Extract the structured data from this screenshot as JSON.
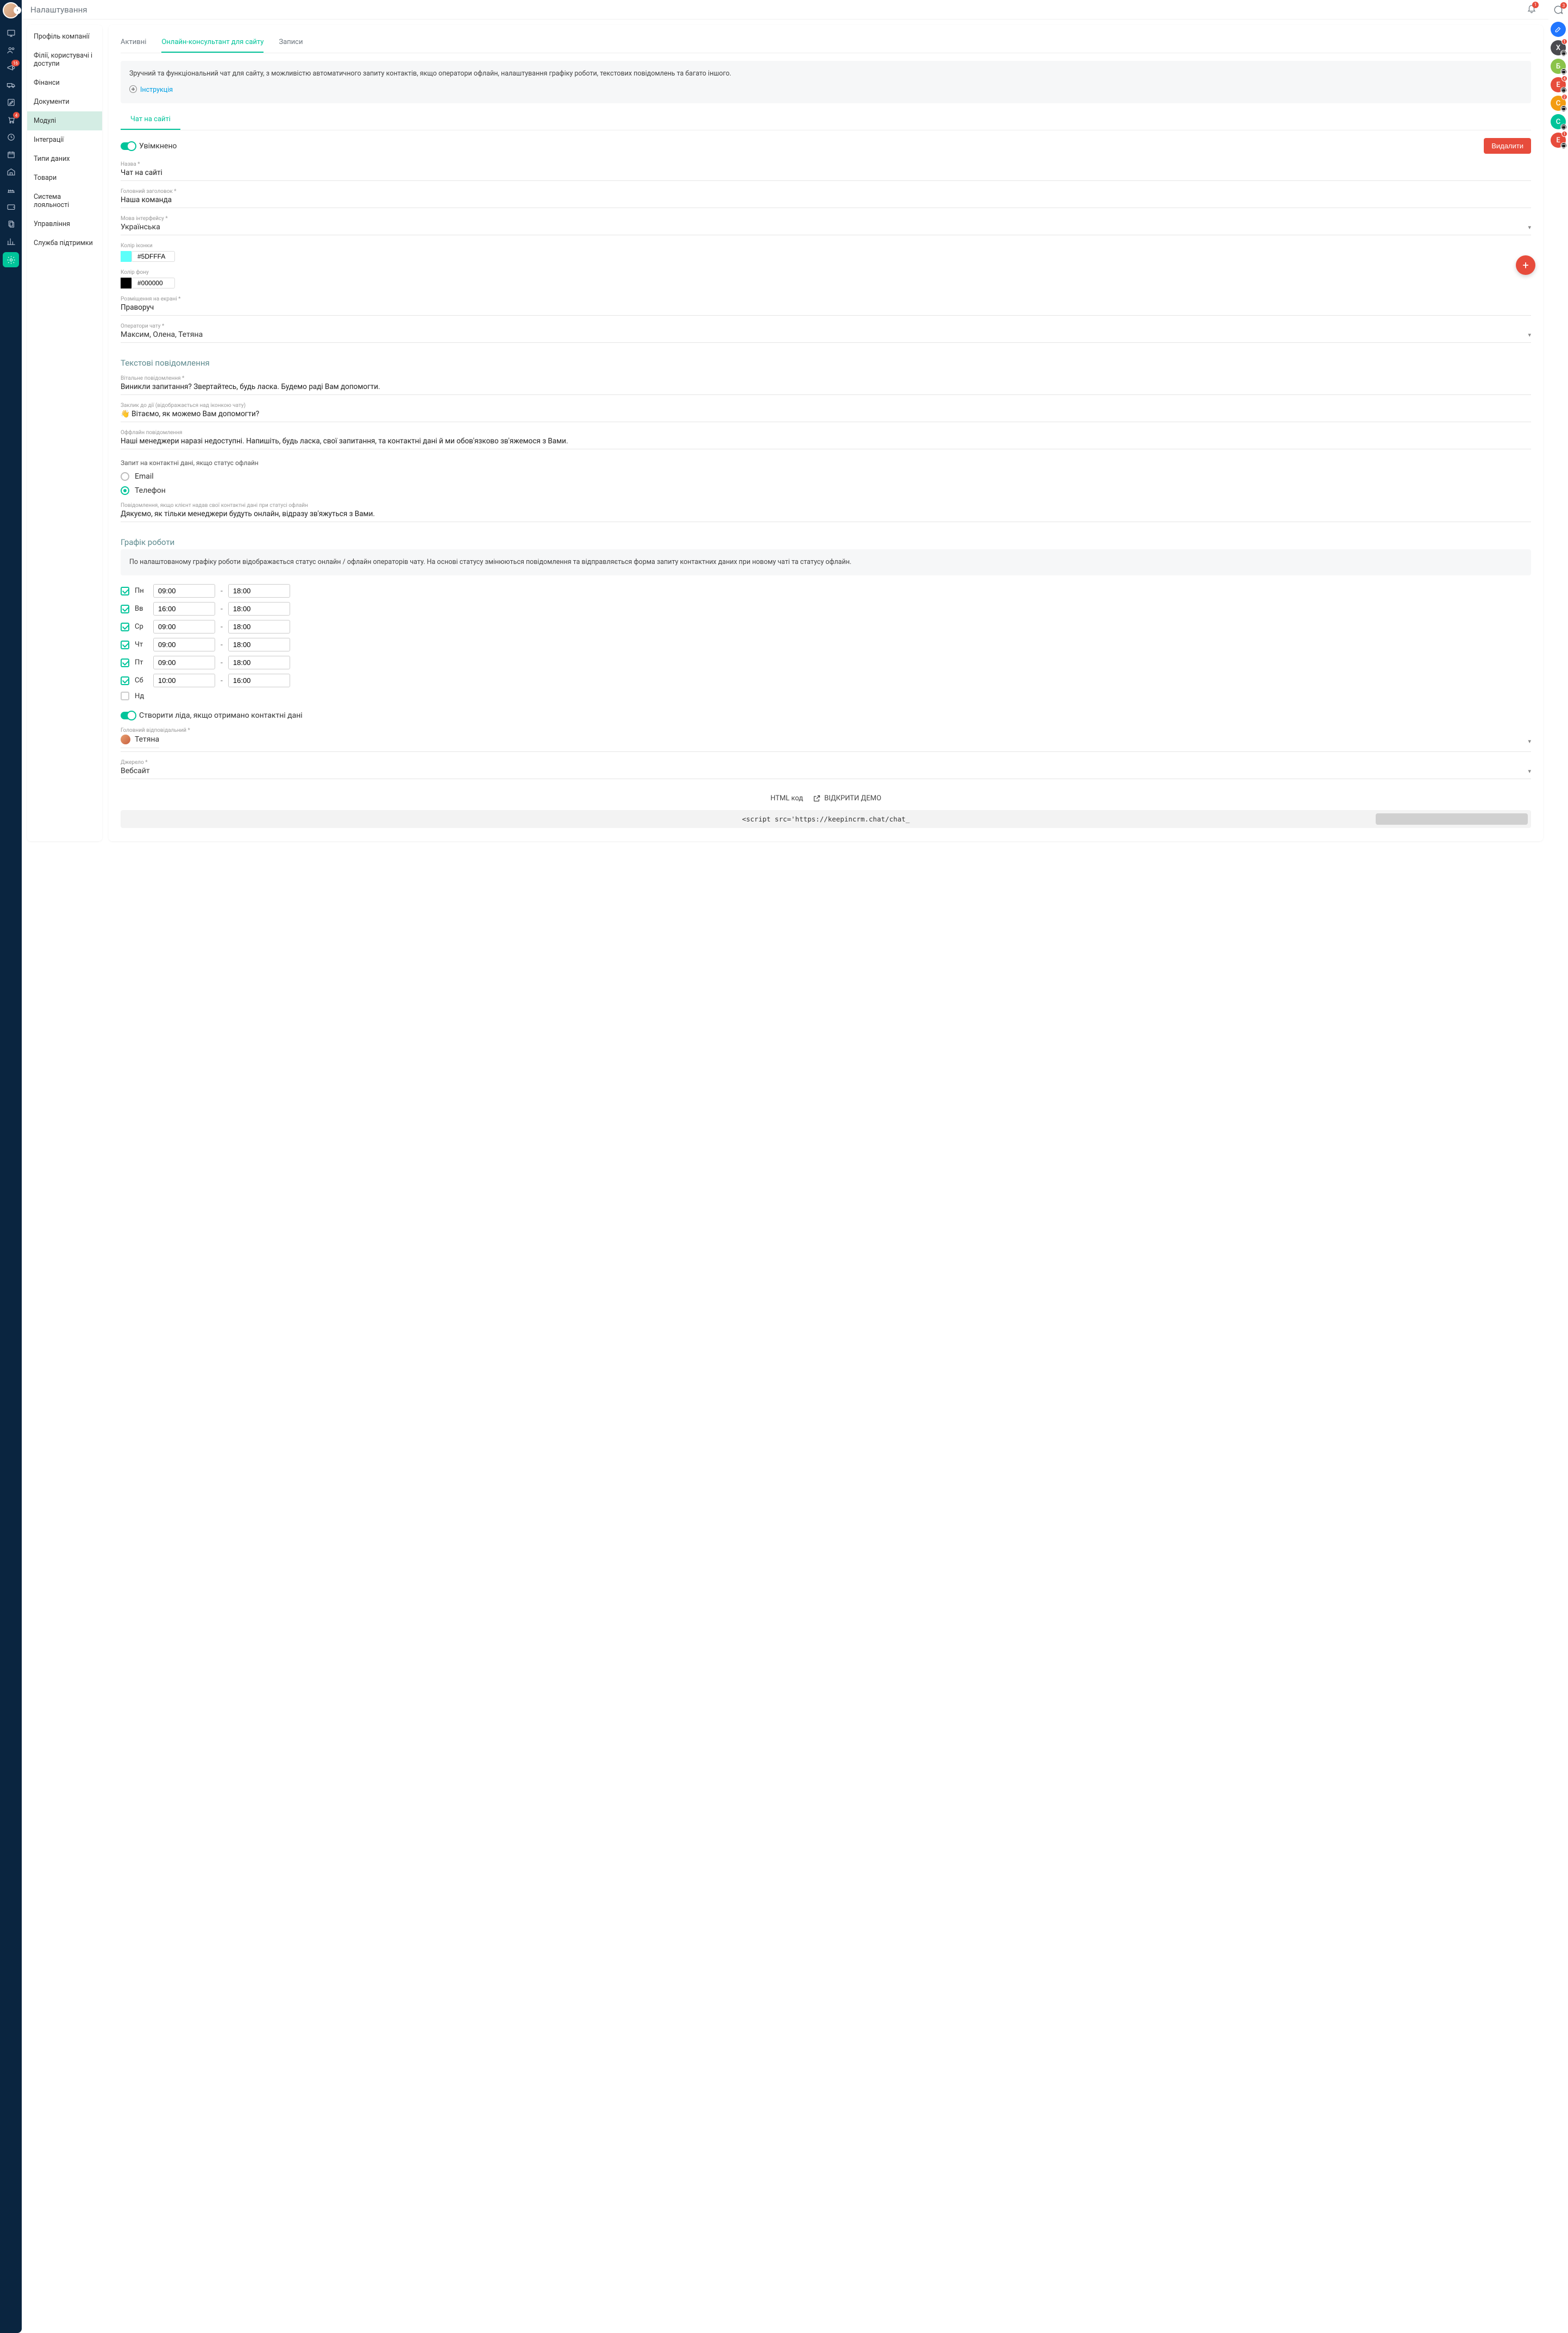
{
  "header": {
    "title": "Налаштування",
    "bell_badge": "1",
    "chat_badge": "3"
  },
  "iconbar_badges": {
    "third": "16",
    "cart": "4"
  },
  "sidebar": {
    "items": [
      "Профіль компанії",
      "Філії, користувачі і доступи",
      "Фінанси",
      "Документи",
      "Модулі",
      "Інтеграції",
      "Типи даних",
      "Товари",
      "Система лояльності",
      "Управління",
      "Служба підтримки"
    ]
  },
  "tabs": [
    "Активні",
    "Онлайн-консультант для сайту",
    "Записи"
  ],
  "info_text": "Зручний та функціональний чат для сайту, з можливістю автоматичного запиту контактів, якщо оператори офлайн, налаштування графіку роботи, текстових повідомлень та багато іншого.",
  "info_link": "Інструкція",
  "sub_tab": "Чат на сайті",
  "enabled_label": "Увімкнено",
  "delete_btn": "Видалити",
  "fields": {
    "name_label": "Назва *",
    "name_value": "Чат на сайті",
    "heading_label": "Головний заголовок *",
    "heading_value": "Наша команда",
    "lang_label": "Мова інтерфейсу *",
    "lang_value": "Українська",
    "icon_color_label": "Колір іконки",
    "icon_color_value": "#5DFFFA",
    "bg_color_label": "Колір фону",
    "bg_color_value": "#000000",
    "placement_label": "Розміщення на екрані *",
    "placement_value": "Праворуч",
    "operators_label": "Оператори чату *",
    "operators_value": "Максим, Олена, Тетяна"
  },
  "text_section": {
    "title": "Текстові повідомлення",
    "welcome_label": "Вітальне повідомлення *",
    "welcome_value": "Виникли запитання? Звертайтесь, будь ласка. Будемо раді Вам допомогти.",
    "cta_label": "Заклик до дії (відображається над іконкою чату)",
    "cta_value": "👋 Вітаємо, як можемо Вам допомогти?",
    "offline_label": "Оффлайн повідомлення",
    "offline_value": "Наші менеджери наразі недоступні. Напишіть, будь ласка, свої запитання, та контактні дані й ми обов'язково зв'яжемося з Вами.",
    "contact_request_title": "Запит на контактні дані, якщо статус офлайн",
    "contact_email": "Email",
    "contact_phone": "Телефон",
    "thank_label": "Повідомлення, якщо клієнт надав свої контактні дані при статусі офлайн",
    "thank_value": "Дякуємо, як тільки менеджери будуть онлайн, відразу зв'яжуться з Вами."
  },
  "schedule": {
    "title": "Графік роботи",
    "info": "По налаштованому графіку роботи відображається статус онлайн / офлайн операторів чату. На основі статусу змінюються повідомлення та відправляється форма запиту контактних даних при новому чаті та статусу офлайн.",
    "days": [
      {
        "label": "Пн",
        "checked": true,
        "from": "09:00",
        "to": "18:00"
      },
      {
        "label": "Вв",
        "checked": true,
        "from": "16:00",
        "to": "18:00"
      },
      {
        "label": "Ср",
        "checked": true,
        "from": "09:00",
        "to": "18:00"
      },
      {
        "label": "Чт",
        "checked": true,
        "from": "09:00",
        "to": "18:00"
      },
      {
        "label": "Пт",
        "checked": true,
        "from": "09:00",
        "to": "18:00"
      },
      {
        "label": "Сб",
        "checked": true,
        "from": "10:00",
        "to": "16:00"
      },
      {
        "label": "Нд",
        "checked": false,
        "from": "",
        "to": ""
      }
    ]
  },
  "lead_toggle_label": "Створити ліда, якщо отримано контактні дані",
  "responsible_label": "Головний відповідальний *",
  "responsible_value": "Тетяна",
  "source_label": "Джерело *",
  "source_value": "Вебсайт",
  "html_code_btn": "HTML код",
  "open_demo_btn": "ВІДКРИТИ ДЕМО",
  "script_text": "<script src='https://keepincrm.chat/chat_",
  "right_bubbles": [
    {
      "letter": "",
      "color": "#2176ff",
      "edit": true
    },
    {
      "letter": "Х",
      "color": "#4a4a4f",
      "badge": "1"
    },
    {
      "letter": "Б",
      "color": "#8bc34a"
    },
    {
      "letter": "Е",
      "color": "#e74c3c",
      "badge": "4"
    },
    {
      "letter": "С",
      "color": "#f39c12",
      "badge": "2"
    },
    {
      "letter": "С",
      "color": "#00c49a"
    },
    {
      "letter": "Е",
      "color": "#e74c3c",
      "badge": "1"
    }
  ]
}
